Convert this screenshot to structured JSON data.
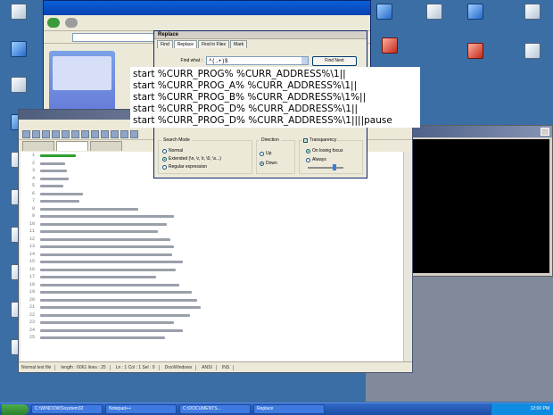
{
  "overlay": {
    "lines": [
      "start  %CURR_PROG% %CURR_ADDRESS%\\1||",
      "start  %CURR_PROG_A% %CURR_ADDRESS%\\1||",
      "start  %CURR_PROG_B% %CURR_ADDRESS%\\1%||",
      "start  %CURR_PROG_D% %CURR_ADDRESS%\\1||",
      "start  %CURR_PROG_D% %CURR_ADDRESS%\\1||||pause"
    ]
  },
  "replace_dialog": {
    "title": "Replace",
    "tabs": [
      "Find",
      "Replace",
      "Find in Files",
      "Mark"
    ],
    "active_tab": "Replace",
    "find_label": "Find what :",
    "find_value": "^(.+)$",
    "find_next_label": "Find Next",
    "search_mode_label": "Search Mode",
    "modes": [
      "Normal",
      "Extended (\\n, \\r, \\t, \\0, \\x...)",
      "Regular expression"
    ],
    "selected_mode": "Extended (\\n, \\r, \\t, \\0, \\x...)",
    "direction_label": "Direction",
    "directions": [
      "Up",
      "Down"
    ],
    "selected_direction": "Down",
    "transparency_label": "Transparency",
    "transparency_options": [
      "On losing focus",
      "Always"
    ]
  },
  "npp": {
    "line_numbers": [
      "1",
      "2",
      "3",
      "4",
      "5",
      "6",
      "7",
      "8",
      "9",
      "10",
      "11",
      "12",
      "13",
      "14",
      "15",
      "16",
      "17",
      "18",
      "19",
      "20",
      "21",
      "22",
      "23",
      "24",
      "25"
    ],
    "status": [
      "Normal text file",
      "length : 6061    lines : 25",
      "Ln : 1    Col : 1    Sel : 0",
      "Dos\\Windows",
      "ANSI",
      "INS"
    ]
  },
  "taskbar": {
    "start_label": "start",
    "tasks": [
      "C:\\WINDOWS\\system32",
      "Notepad++",
      "C:\\DOCUMENTS...",
      "Replace"
    ],
    "clock": "12:00 PM"
  },
  "colors": {
    "desktop": "#3a6ea5",
    "highlight_line": "#2d9f2d"
  }
}
